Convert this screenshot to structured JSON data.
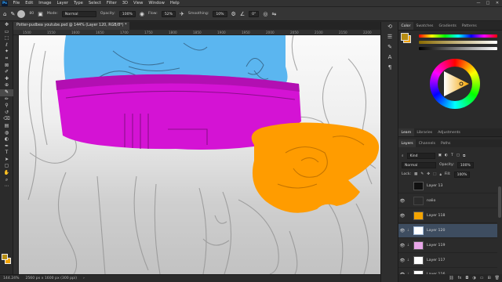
{
  "menubar": {
    "app_logo": "Ps",
    "items": [
      "File",
      "Edit",
      "Image",
      "Layer",
      "Type",
      "Select",
      "Filter",
      "3D",
      "View",
      "Window",
      "Help"
    ],
    "window_controls": [
      "—",
      "□",
      "✕"
    ]
  },
  "options": {
    "mode_label": "Mode:",
    "mode_value": "Normal",
    "opacity_label": "Opacity:",
    "opacity_value": "100%",
    "flow_label": "Flow:",
    "flow_value": "52%",
    "smoothing_label": "Smoothing:",
    "smoothing_value": "10%",
    "angle_value": "0°",
    "brush_size": "80"
  },
  "document": {
    "tab_title": "Potter-pudbea youtube.psd @ 144% (Layer 120, RGB/8*) *",
    "ruler_ticks": [
      "1500",
      "1550",
      "1600",
      "1650",
      "1700",
      "1750",
      "1800",
      "1850",
      "1900",
      "1950",
      "2000",
      "2050",
      "2100",
      "2150",
      "2200"
    ]
  },
  "statusbar": {
    "zoom": "144.24%",
    "doc_info": "2560 px x 1600 px (300 ppi)"
  },
  "color_panel": {
    "tabs": [
      "Color",
      "Swatches",
      "Gradients",
      "Patterns"
    ],
    "active_tab": "Color",
    "foreground_color": "#b78d12",
    "background_color": "#f4a400"
  },
  "learn_panel": {
    "tabs": [
      "Learn",
      "Libraries",
      "Adjustments"
    ]
  },
  "layers_panel": {
    "tabs": [
      "Layers",
      "Channels",
      "Paths"
    ],
    "active_tab": "Layers",
    "filter_kind": "Kind",
    "blend_mode": "Normal",
    "opacity_label": "Opacity:",
    "opacity_value": "100%",
    "lock_label": "Lock:",
    "fill_label": "Fill:",
    "fill_value": "100%",
    "layers": [
      {
        "name": "Layer 13",
        "thumb": "#111111",
        "selected": false
      },
      {
        "name": "nalio",
        "thumb": "#2b2b2b",
        "selected": false
      },
      {
        "name": "Layer 118",
        "thumb": "#f4a400",
        "selected": false
      },
      {
        "name": "Layer 120",
        "thumb": "#ffffff",
        "selected": true
      },
      {
        "name": "Layer 119",
        "thumb": "#e8a6e8",
        "selected": false
      },
      {
        "name": "Layer 117",
        "thumb": "#ffffff",
        "selected": false
      },
      {
        "name": "Layer 116",
        "thumb": "#ffffff",
        "selected": false
      }
    ]
  },
  "artwork_colors": {
    "blue": "#5bb6f0",
    "magenta": "#d413d4",
    "orange": "#ff9c00"
  }
}
